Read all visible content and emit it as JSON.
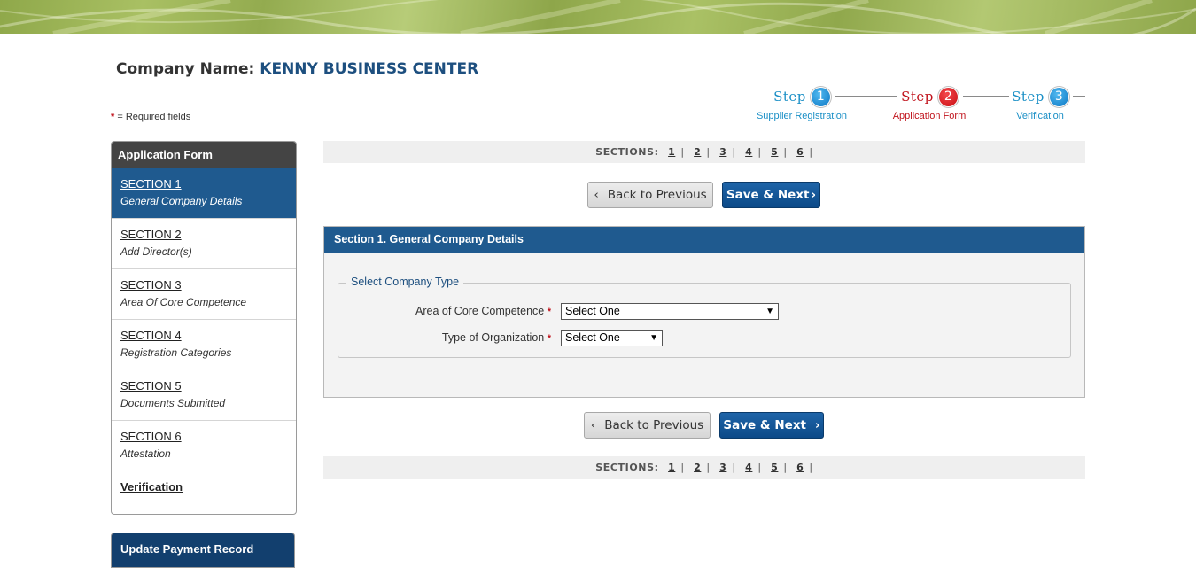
{
  "company": {
    "label": "Company Name:",
    "value": "KENNY BUSINESS CENTER"
  },
  "steps": [
    {
      "word": "Step",
      "number": "1",
      "caption": "Supplier Registration"
    },
    {
      "word": "Step",
      "number": "2",
      "caption": "Application Form"
    },
    {
      "word": "Step",
      "number": "3",
      "caption": "Verification"
    }
  ],
  "required_note": {
    "star": "*",
    "text": "= Required fields"
  },
  "sidebar": {
    "title": "Application Form",
    "items": [
      {
        "title": "SECTION 1",
        "desc": "General Company Details"
      },
      {
        "title": "SECTION 2",
        "desc": "Add Director(s)"
      },
      {
        "title": "SECTION 3",
        "desc": "Area Of Core Competence"
      },
      {
        "title": "SECTION 4",
        "desc": "Registration Categories"
      },
      {
        "title": "SECTION 5",
        "desc": "Documents Submitted"
      },
      {
        "title": "SECTION 6",
        "desc": "Attestation"
      }
    ],
    "verification": "Verification",
    "payment": "Update Payment Record"
  },
  "sections_nav": {
    "label": "SECTIONS:",
    "links": [
      "1",
      "2",
      "3",
      "4",
      "5",
      "6"
    ],
    "separator": "|"
  },
  "buttons": {
    "prev_arrow": "‹",
    "prev_label": "Back to Previous",
    "next_label": "Save & Next",
    "next_arrow": "›"
  },
  "panel": {
    "title": "Section 1. General Company Details",
    "legend": "Select Company Type",
    "fields": [
      {
        "label": "Area of Core Competence",
        "star": "*",
        "value": "Select One"
      },
      {
        "label": "Type of Organization",
        "star": "*",
        "value": "Select One"
      }
    ]
  },
  "colors": {
    "accent_blue": "#1f5a8f",
    "step_blue": "#1a8fc6",
    "step_red": "#c0121b",
    "banner_green": "#9bb456"
  }
}
